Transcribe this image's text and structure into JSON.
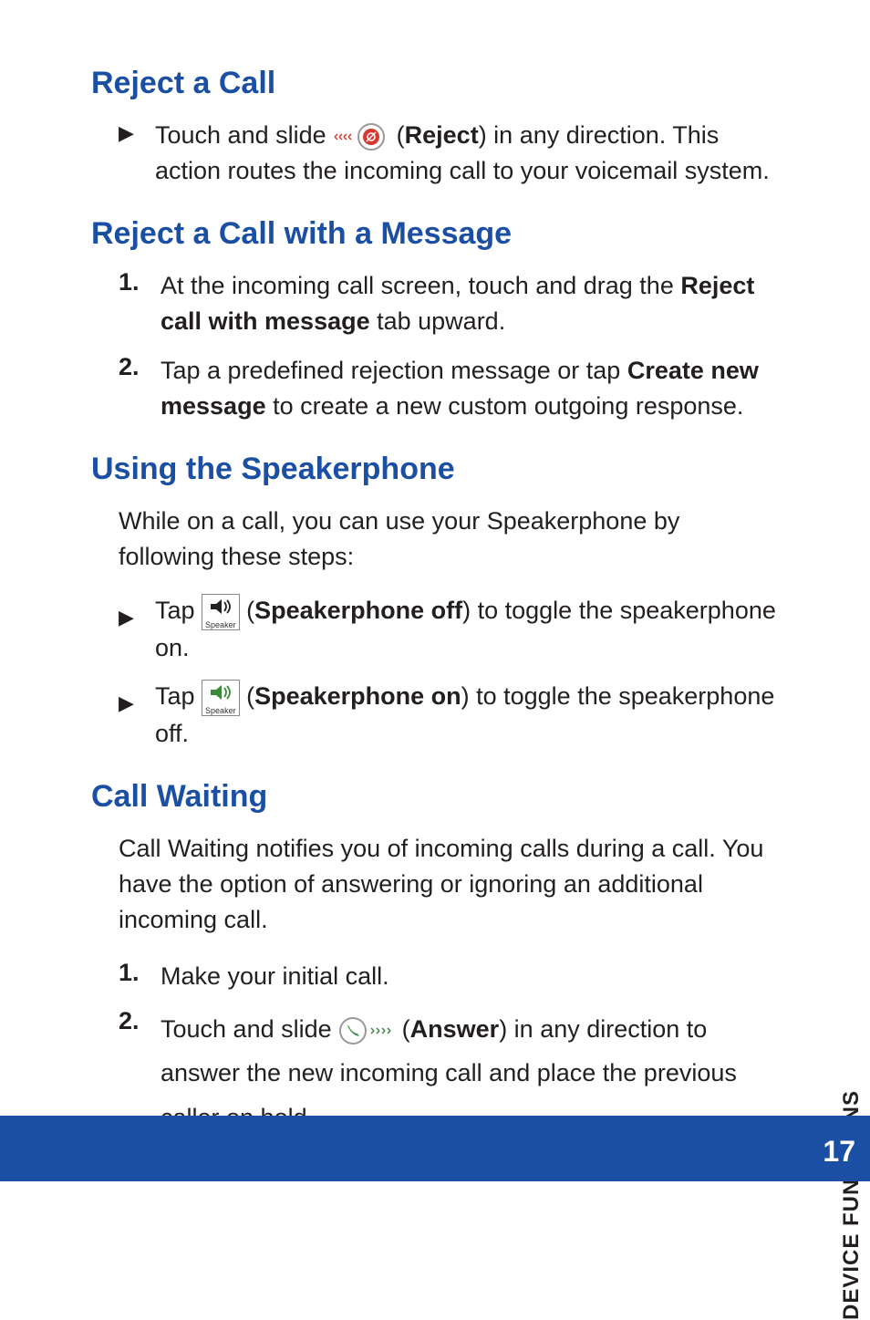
{
  "sideLabel": "DEVICE FUNCTIONS",
  "pageNumber": "17",
  "sections": {
    "rejectCall": {
      "heading": "Reject a Call",
      "bullet1_a": "Touch and slide ",
      "bullet1_b": "Reject",
      "bullet1_c": ") in any direction. This action routes the incoming call to your voicemail system."
    },
    "rejectMsg": {
      "heading": "Reject a Call with a Message",
      "step1_a": "At the incoming call screen, touch and drag the ",
      "step1_b": "Reject call with message",
      "step1_c": " tab upward.",
      "step2_a": "Tap a predefined rejection message or tap ",
      "step2_b": "Create new message",
      "step2_c": " to create a new custom outgoing response."
    },
    "speakerphone": {
      "heading": "Using the Speakerphone",
      "intro": "While on a call, you can use your Speakerphone by following these steps:",
      "b1_a": "Tap ",
      "b1_b": "Speakerphone off",
      "b1_c": ") to toggle the speakerphone on.",
      "b2_a": "Tap ",
      "b2_b": "Speakerphone on",
      "b2_c": ") to toggle the speakerphone off.",
      "iconCaption": "Speaker"
    },
    "callWaiting": {
      "heading": "Call Waiting",
      "intro": "Call Waiting notifies you of incoming calls during a call. You have the option of answering or ignoring an additional incoming call.",
      "step1": "Make your initial call.",
      "step2_a": "Touch and slide ",
      "step2_b": "Answer",
      "step2_c": ") in any direction to answer the new incoming call and place the previous caller on hold."
    }
  },
  "listMarkers": {
    "one": "1.",
    "two": "2."
  }
}
